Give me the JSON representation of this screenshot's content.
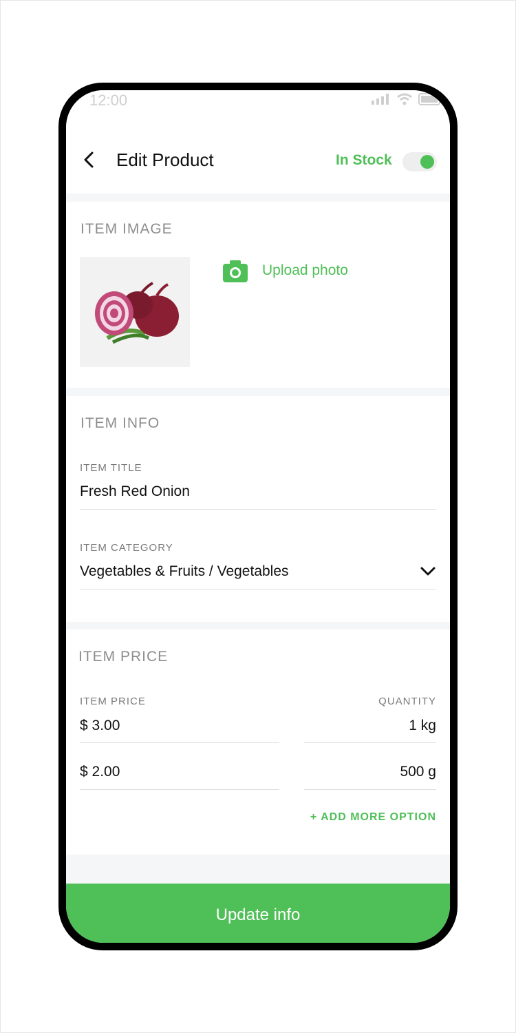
{
  "status_bar": {
    "time": "12:00",
    "icons": [
      "signal-icon",
      "wifi-icon",
      "battery-icon"
    ]
  },
  "header": {
    "back_icon": "back-arrow-icon",
    "title": "Edit Product",
    "stock_label": "In Stock",
    "stock_toggle_on": true
  },
  "image_section": {
    "title": "ITEM IMAGE",
    "upload_icon": "camera-icon",
    "upload_label": "Upload photo",
    "product_image": "red-onion-photo"
  },
  "info_section": {
    "title": "ITEM INFO",
    "item_title_label": "ITEM TITLE",
    "item_title_value": "Fresh Red Onion",
    "item_category_label": "ITEM CATEGORY",
    "item_category_value": "Vegetables & Fruits / Vegetables",
    "category_dropdown_icon": "chevron-down-icon"
  },
  "price_section": {
    "title": "ITEM PRICE",
    "price_label": "ITEM PRICE",
    "quantity_label": "QUANTITY",
    "options": [
      {
        "price": "$ 3.00",
        "quantity": "1 kg"
      },
      {
        "price": "$ 2.00",
        "quantity": "500 g"
      }
    ],
    "add_option_label": "+ ADD MORE OPTION"
  },
  "footer": {
    "update_label": "Update info"
  },
  "colors": {
    "accent": "#4fbf57",
    "background": "#f5f6f8",
    "text": "#111111",
    "muted": "#8d8d8d"
  }
}
